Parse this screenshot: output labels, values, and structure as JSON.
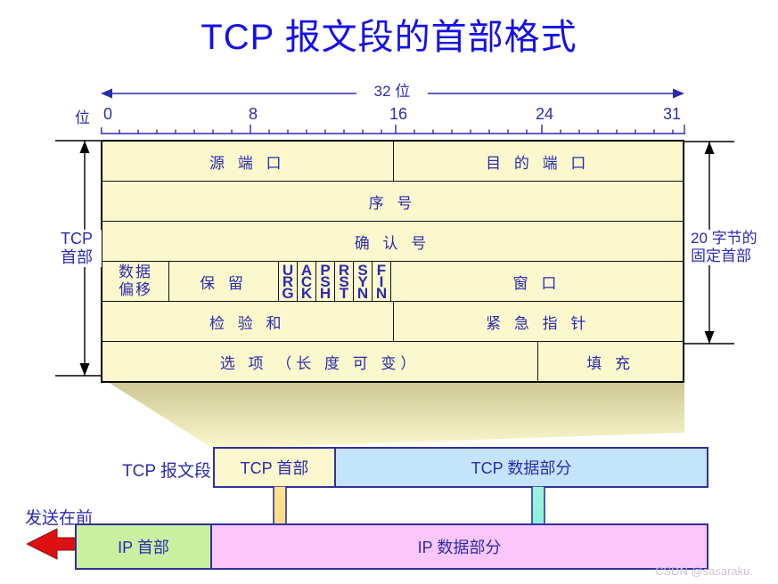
{
  "title": "TCP 报文段的首部格式",
  "scale": {
    "span_label": "32 位",
    "bit_word": "位",
    "ticks": [
      "0",
      "8",
      "16",
      "24",
      "31"
    ]
  },
  "measures": {
    "left_label_line1": "TCP",
    "left_label_line2": "首部",
    "right_label_line1": "20 字节的",
    "right_label_line2": "固定首部"
  },
  "tcp_header": {
    "rows": [
      {
        "cells": [
          {
            "label": "源 端 口",
            "bits": 16
          },
          {
            "label": "目 的 端 口",
            "bits": 16
          }
        ]
      },
      {
        "cells": [
          {
            "label": "序   号",
            "bits": 32
          }
        ]
      },
      {
        "cells": [
          {
            "label": "确  认  号",
            "bits": 32
          }
        ]
      },
      {
        "cells": [
          {
            "label_line1": "数据",
            "label_line2": "偏移",
            "bits": 4
          },
          {
            "label": "保   留",
            "bits": 6
          },
          {
            "flag": "URG"
          },
          {
            "flag": "ACK"
          },
          {
            "flag": "PSH"
          },
          {
            "flag": "RST"
          },
          {
            "flag": "SYN"
          },
          {
            "flag": "FIN"
          },
          {
            "label": "窗   口",
            "bits": 16
          }
        ]
      },
      {
        "cells": [
          {
            "label": "检 验 和",
            "bits": 16
          },
          {
            "label": "紧 急 指 针",
            "bits": 16
          }
        ]
      },
      {
        "cells": [
          {
            "label": "选  项  （长 度 可 变）",
            "bits": 24
          },
          {
            "label": "填  充",
            "bits": 8
          }
        ]
      }
    ]
  },
  "segment": {
    "label": "TCP 报文段",
    "header": "TCP 首部",
    "data": "TCP 数据部分"
  },
  "packet": {
    "send_first": "发送在前",
    "header": "IP 首部",
    "data": "IP 数据部分"
  },
  "watermark": "CSDN @sasaraku.",
  "colors": {
    "title": "#1510e8",
    "text": "#2b2bb0",
    "tcp_header_fill": "#fbf8cd",
    "tcp_data_fill": "#c4e4fb",
    "ip_header_fill": "#c8f0a0",
    "ip_data_fill": "#fbc7fb",
    "strip_border": "#31319c",
    "red_arrow": "#dd1111",
    "yellow_arrow": "#ffd977",
    "teal_arrow": "#8af0de"
  }
}
